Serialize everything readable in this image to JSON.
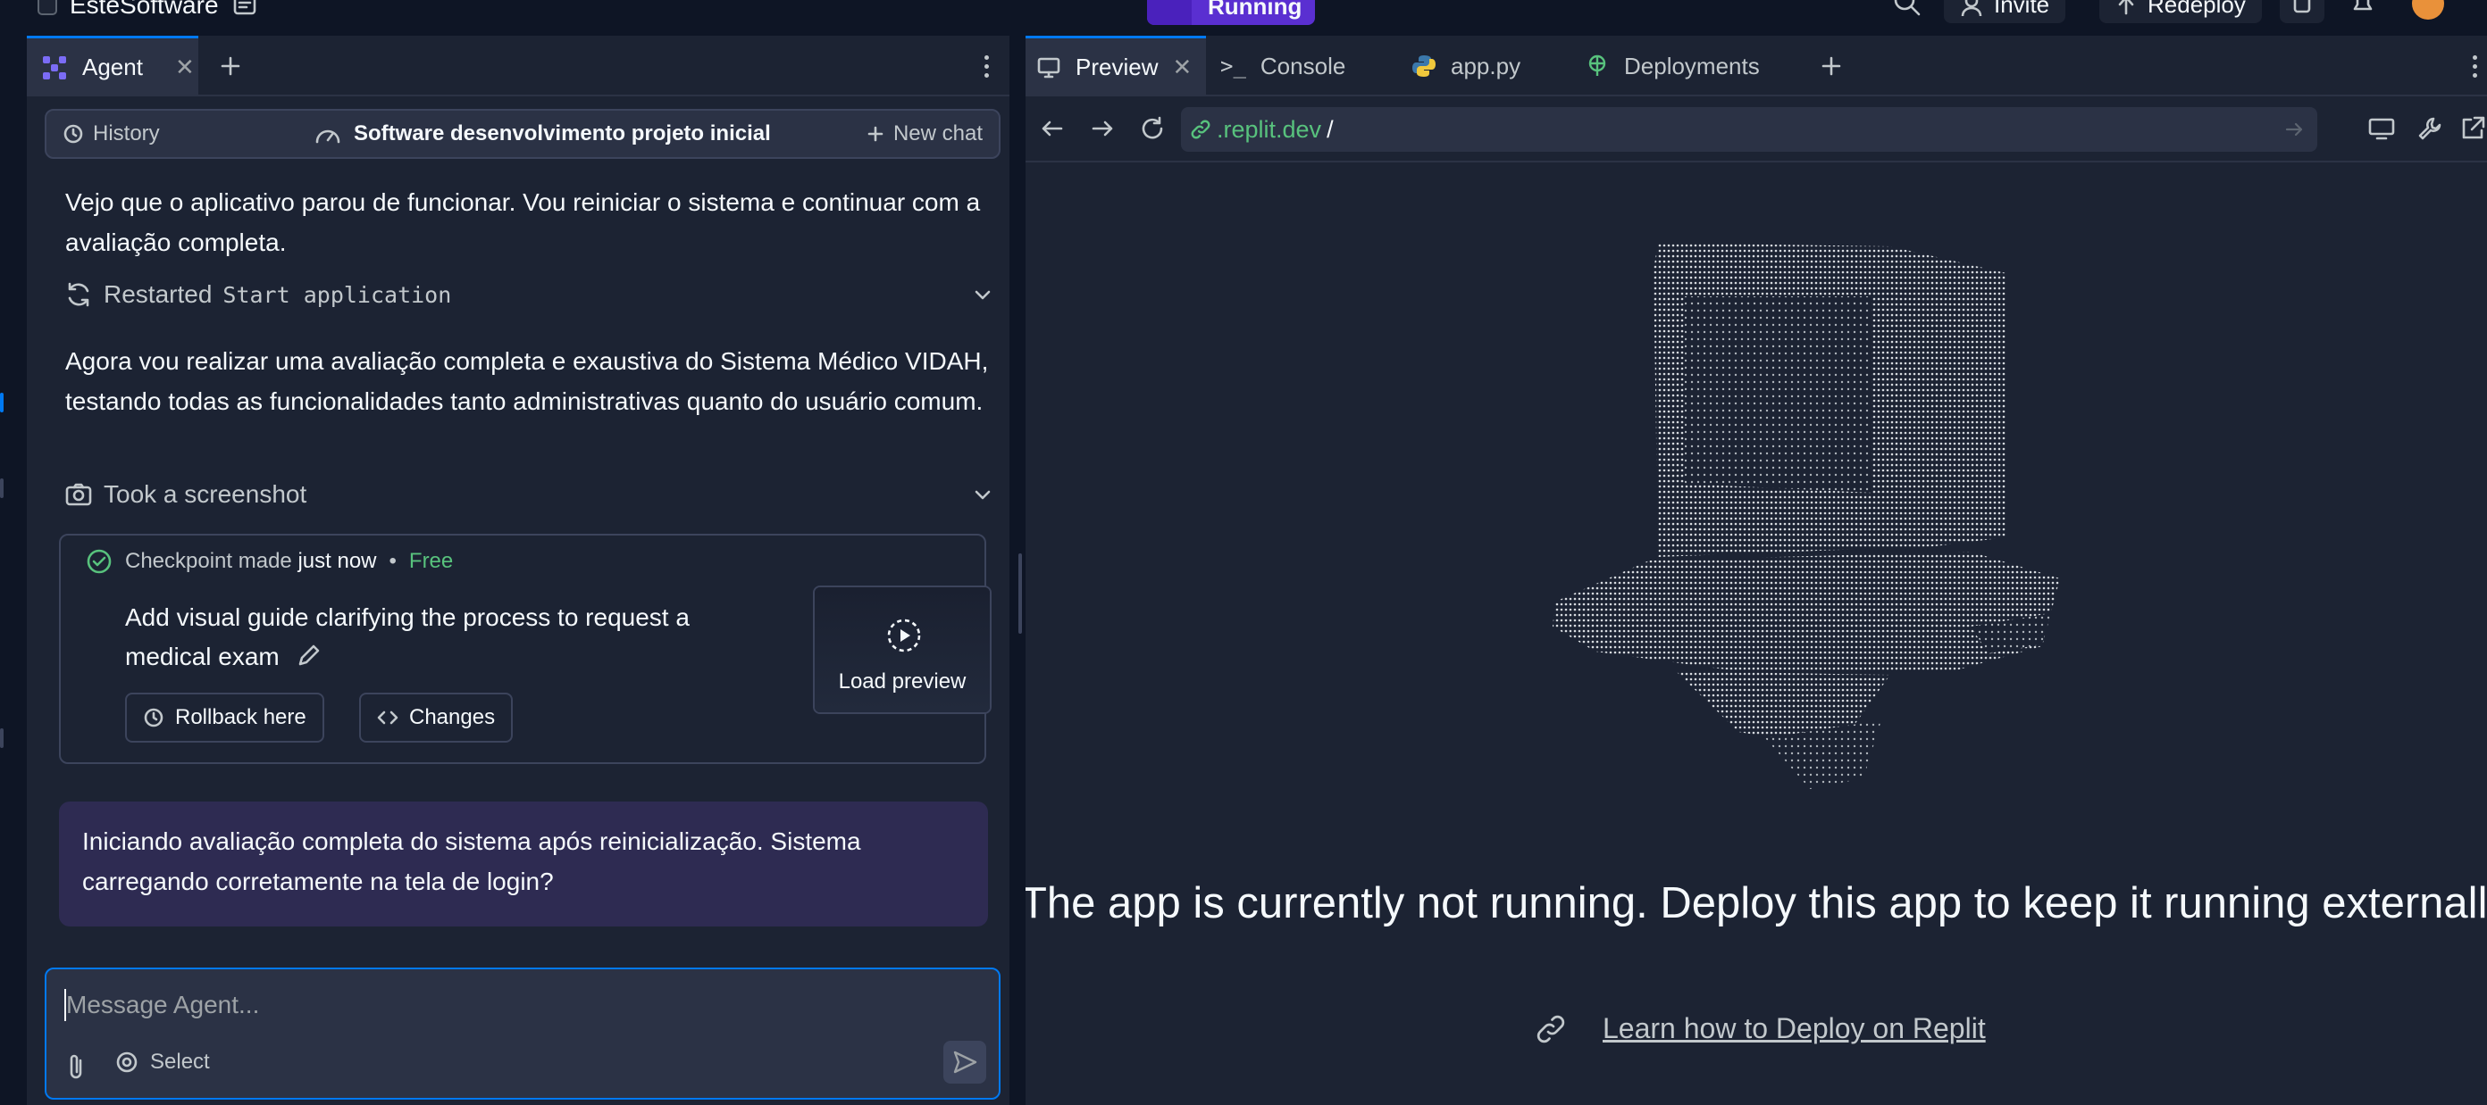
{
  "topbar": {
    "project_name": "EsteSoftware",
    "run_status": "Running",
    "invite_label": "Invite",
    "redeploy_label": "Redeploy"
  },
  "left_panel": {
    "tabs": [
      {
        "label": "Agent",
        "active": true
      }
    ],
    "chat_header": {
      "history_label": "History",
      "title": "Software desenvolvimento projeto inicial",
      "new_chat_label": "New chat"
    },
    "messages": [
      {
        "type": "agent",
        "text": "Vejo que o aplicativo parou de funcionar. Vou reiniciar o sistema e continuar com a avaliação completa."
      },
      {
        "type": "action",
        "verb": "Restarted",
        "target": "Start application",
        "icon": "refresh-icon"
      },
      {
        "type": "agent",
        "text": "Agora vou realizar uma avaliação completa e exaustiva do Sistema Médico VIDAH, testando todas as funcionalidades tanto administrativas quanto do usuário comum."
      },
      {
        "type": "action",
        "verb": "Took a screenshot",
        "target": "",
        "icon": "camera-icon"
      }
    ],
    "checkpoint": {
      "made_label": "Checkpoint made",
      "time": "just now",
      "separator": "•",
      "price": "Free",
      "description": "Add visual guide clarifying the process to request a medical exam",
      "rollback_label": "Rollback here",
      "changes_label": "Changes",
      "preview_label": "Load preview"
    },
    "user_message": "Iniciando avaliação completa do sistema após reinicialização. Sistema carregando corretamente na tela de login?",
    "composer": {
      "placeholder": "Message Agent...",
      "select_label": "Select"
    }
  },
  "right_panel": {
    "tabs": [
      {
        "label": "Preview",
        "icon": "monitor-icon",
        "active": true
      },
      {
        "label": "Console",
        "icon": "terminal-icon",
        "active": false
      },
      {
        "label": "app.py",
        "icon": "python-icon",
        "active": false
      },
      {
        "label": "Deployments",
        "icon": "deploy-icon",
        "active": false
      }
    ],
    "url": {
      "host": ".replit.dev",
      "path": "/"
    },
    "preview": {
      "headline": "The app is currently not running. Deploy this app to keep it running externally.",
      "link_label": "Learn how to Deploy on Replit"
    }
  },
  "colors": {
    "background": "#0e1525",
    "panel": "#1c2333",
    "surface": "#2b3245",
    "accent_blue": "#0079f2",
    "accent_purple": "#5a2fd1",
    "success_green": "#58c27d",
    "user_bubble": "#2e2b52"
  }
}
